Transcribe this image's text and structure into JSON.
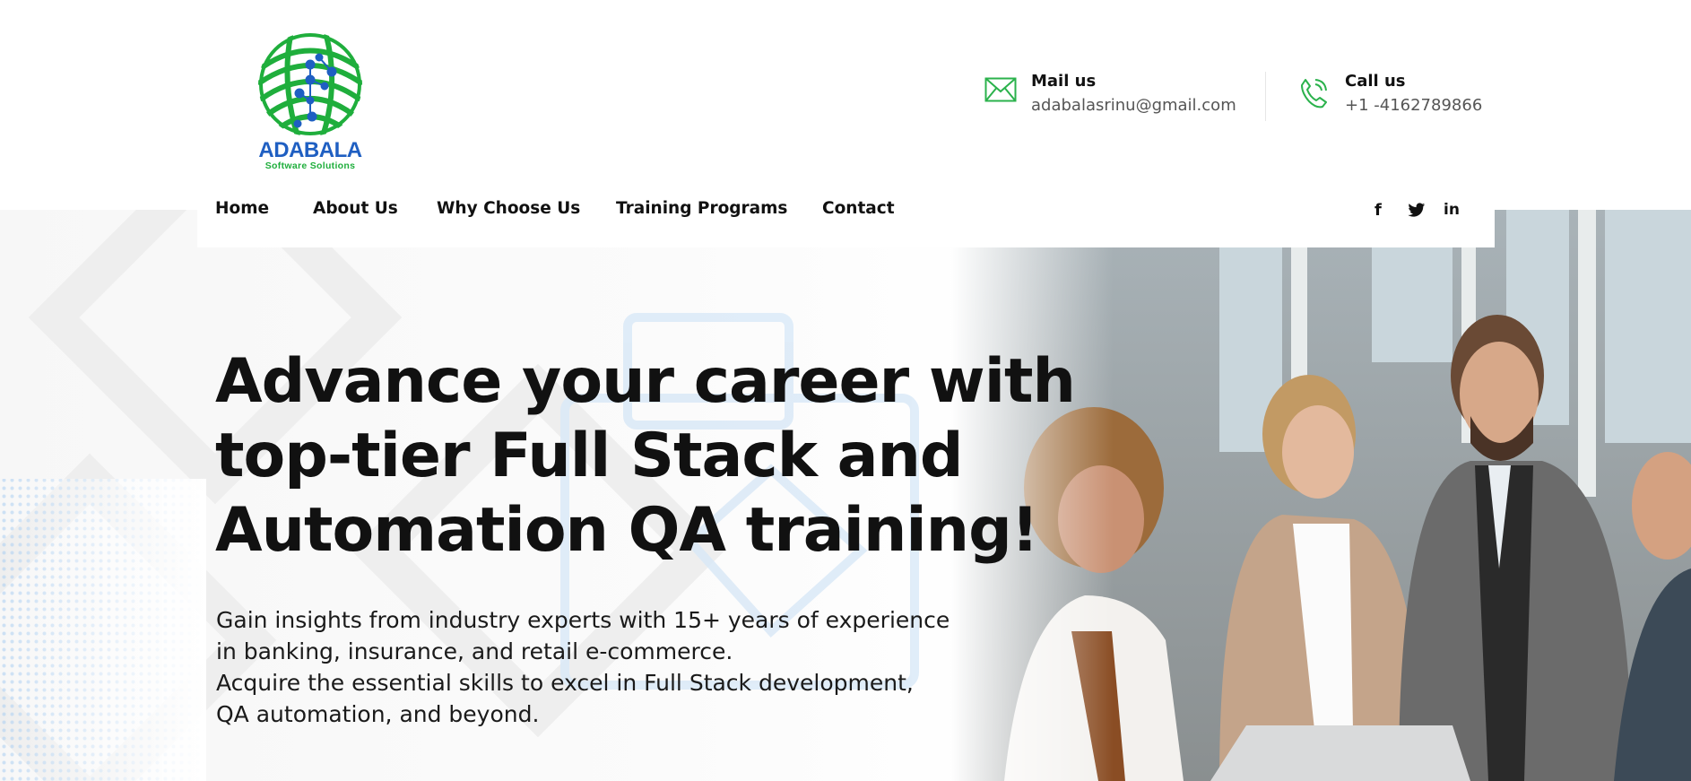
{
  "brand": {
    "name": "ADABALA",
    "tagline": "Software Solutions",
    "colors": {
      "green": "#1fae3c",
      "blue": "#1f5fc2"
    }
  },
  "contact": {
    "mail": {
      "icon": "mail-icon",
      "label": "Mail us",
      "value": "adabalasrinu@gmail.com"
    },
    "call": {
      "icon": "phone-icon",
      "label": "Call us",
      "value": "+1 -4162789866"
    }
  },
  "nav": {
    "items": [
      "Home",
      "About Us",
      "Why Choose Us",
      "Training Programs",
      "Contact"
    ],
    "social": [
      "f",
      "twitter-icon",
      "in"
    ]
  },
  "hero": {
    "title_lines": [
      "Advance your career with",
      "top-tier Full Stack and",
      "Automation QA training!"
    ],
    "subtitle_lines": [
      "Gain insights from industry experts with 15+ years of experience",
      "in banking, insurance, and retail e-commerce.",
      "Acquire the essential skills to excel in Full Stack development,",
      "QA automation, and beyond."
    ]
  }
}
